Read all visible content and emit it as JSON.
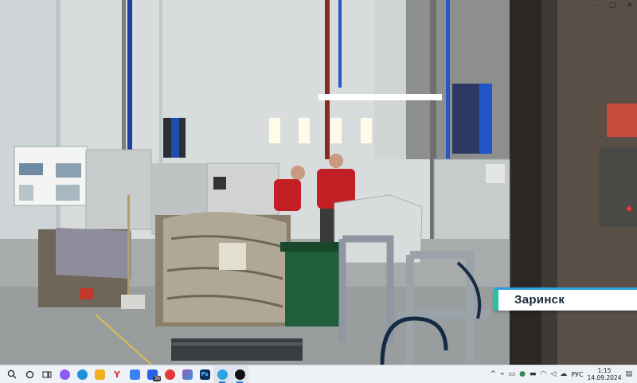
{
  "video": {
    "caption_city": "Заринск"
  },
  "window": {
    "minimize": "–",
    "maximize": "□",
    "close": "✕"
  },
  "taskbar": {
    "items": [
      {
        "name": "search",
        "color": "#222"
      },
      {
        "name": "cortana",
        "color": "#222"
      },
      {
        "name": "task-view",
        "color": "#222"
      },
      {
        "name": "purple-app",
        "color": "#8b5cf6"
      },
      {
        "name": "edge",
        "color": "#1f8fd8"
      },
      {
        "name": "file-explorer",
        "color": "#f2b01e"
      },
      {
        "name": "yandex-browser",
        "color": "#e32b2b"
      },
      {
        "name": "store",
        "color": "#3b82f6"
      },
      {
        "name": "mail",
        "color": "#2563eb"
      },
      {
        "name": "wps",
        "color": "#e53935"
      },
      {
        "name": "photos",
        "color": "#9b59b6"
      },
      {
        "name": "photoshop",
        "color": "#0b2c5c"
      },
      {
        "name": "telegram",
        "color": "#2aa3df"
      },
      {
        "name": "media-player",
        "color": "#111"
      }
    ],
    "mail_badge": "36",
    "tray": {
      "language": "РУС",
      "time": "1:15",
      "date": "14.09.2024"
    }
  }
}
